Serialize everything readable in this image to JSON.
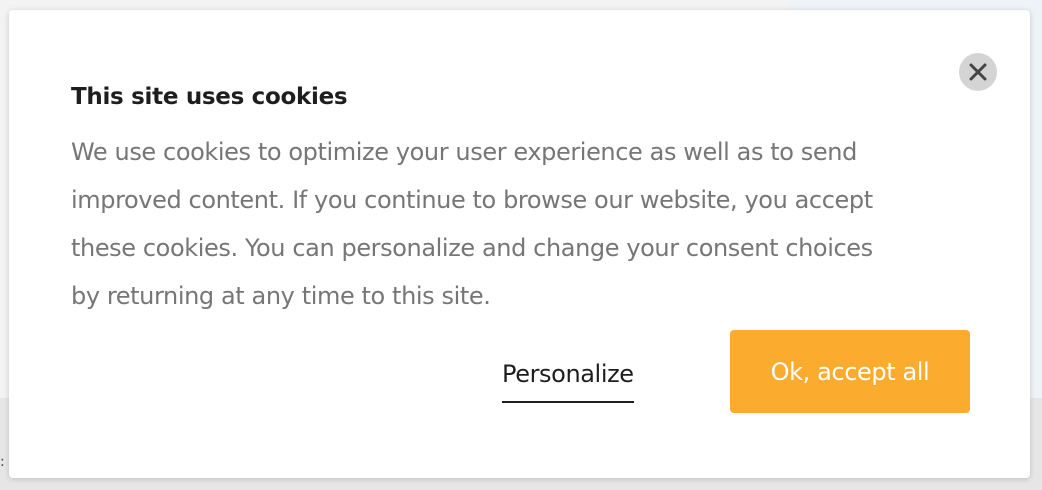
{
  "dialog": {
    "title": "This site uses cookies",
    "body_lines": [
      "We use cookies to optimize your user experience as well as to send",
      "improved content. If you continue to browse our website, you accept",
      "these cookies. You can personalize and change your consent choices",
      "by returning at any time to this site."
    ],
    "personalize_label": "Personalize",
    "accept_label": "Ok, accept all",
    "close_icon": "close-icon"
  },
  "colors": {
    "accent": "#fbac2f",
    "title": "#1e1e1e",
    "body_text": "#767676",
    "close_bg": "#d4d4d4"
  }
}
